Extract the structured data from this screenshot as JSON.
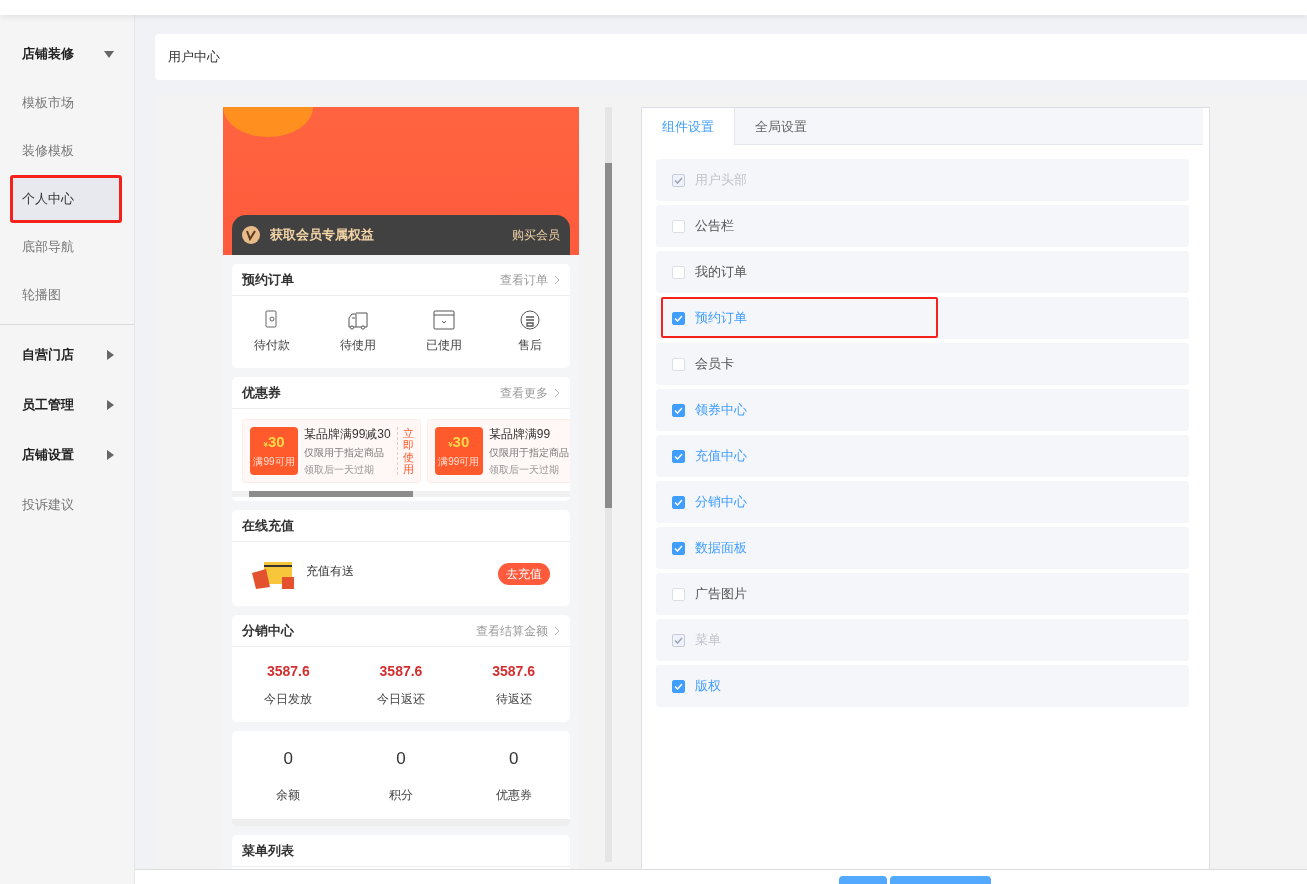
{
  "sidebar": {
    "items": [
      {
        "kind": "group",
        "label": "店铺装修",
        "expanded": true,
        "children": [
          {
            "label": "模板市场",
            "selected": false,
            "highlighted": false
          },
          {
            "label": "装修模板",
            "selected": false,
            "highlighted": false
          },
          {
            "label": "个人中心",
            "selected": true,
            "highlighted": true
          },
          {
            "label": "底部导航",
            "selected": false,
            "highlighted": false
          },
          {
            "label": "轮播图",
            "selected": false,
            "highlighted": false
          }
        ]
      },
      {
        "kind": "group",
        "label": "自营门店",
        "expanded": false
      },
      {
        "kind": "group",
        "label": "员工管理",
        "expanded": false
      },
      {
        "kind": "group",
        "label": "店铺设置",
        "expanded": false
      },
      {
        "kind": "link",
        "label": "投诉建议"
      }
    ]
  },
  "page_header": {
    "title": "用户中心"
  },
  "preview": {
    "member_bar": {
      "text": "获取会员专属权益",
      "action": "购买会员"
    },
    "orders": {
      "title": "预约订单",
      "link": "查看订单",
      "items": [
        {
          "kind": "wallet",
          "label": "待付款"
        },
        {
          "kind": "truck",
          "label": "待使用"
        },
        {
          "kind": "box",
          "label": "已使用"
        },
        {
          "kind": "service",
          "label": "售后"
        }
      ]
    },
    "coupons": {
      "title": "优惠券",
      "link": "查看更多",
      "items": [
        {
          "currency": "¥",
          "amount": "30",
          "condition": "满99可用",
          "title": "某品牌满99减30",
          "note": "仅限用于指定商品",
          "expiry": "领取后一天过期",
          "action": "立即使用"
        },
        {
          "currency": "¥",
          "amount": "30",
          "condition": "满99可用",
          "title": "某品牌满99",
          "note": "仅限用于指定商品",
          "expiry": "领取后一天过期"
        }
      ]
    },
    "recharge": {
      "title": "在线充值",
      "text": "充值有送",
      "button": "去充值"
    },
    "distribution": {
      "title": "分销中心",
      "link": "查看结算金额",
      "stats": [
        {
          "value": "3587.6",
          "label": "今日发放"
        },
        {
          "value": "3587.6",
          "label": "今日返还"
        },
        {
          "value": "3587.6",
          "label": "待返还"
        }
      ]
    },
    "assets": [
      {
        "value": "0",
        "label": "余额"
      },
      {
        "value": "0",
        "label": "积分"
      },
      {
        "value": "0",
        "label": "优惠券"
      }
    ],
    "menu_list": {
      "title": "菜单列表"
    }
  },
  "settings": {
    "tabs": [
      {
        "label": "组件设置",
        "selected": true
      },
      {
        "label": "全局设置",
        "selected": false
      }
    ],
    "components": [
      {
        "label": "用户头部",
        "checked": true,
        "disabled": true,
        "highlighted": false
      },
      {
        "label": "公告栏",
        "checked": false,
        "disabled": false,
        "highlighted": false
      },
      {
        "label": "我的订单",
        "checked": false,
        "disabled": false,
        "highlighted": false
      },
      {
        "label": "预约订单",
        "checked": true,
        "disabled": false,
        "highlighted": true
      },
      {
        "label": "会员卡",
        "checked": false,
        "disabled": false,
        "highlighted": false
      },
      {
        "label": "领券中心",
        "checked": true,
        "disabled": false,
        "highlighted": false
      },
      {
        "label": "充值中心",
        "checked": true,
        "disabled": false,
        "highlighted": false
      },
      {
        "label": "分销中心",
        "checked": true,
        "disabled": false,
        "highlighted": false
      },
      {
        "label": "数据面板",
        "checked": true,
        "disabled": false,
        "highlighted": false
      },
      {
        "label": "广告图片",
        "checked": false,
        "disabled": false,
        "highlighted": false
      },
      {
        "label": "菜单",
        "checked": true,
        "disabled": true,
        "highlighted": false
      },
      {
        "label": "版权",
        "checked": true,
        "disabled": false,
        "highlighted": false
      }
    ]
  }
}
